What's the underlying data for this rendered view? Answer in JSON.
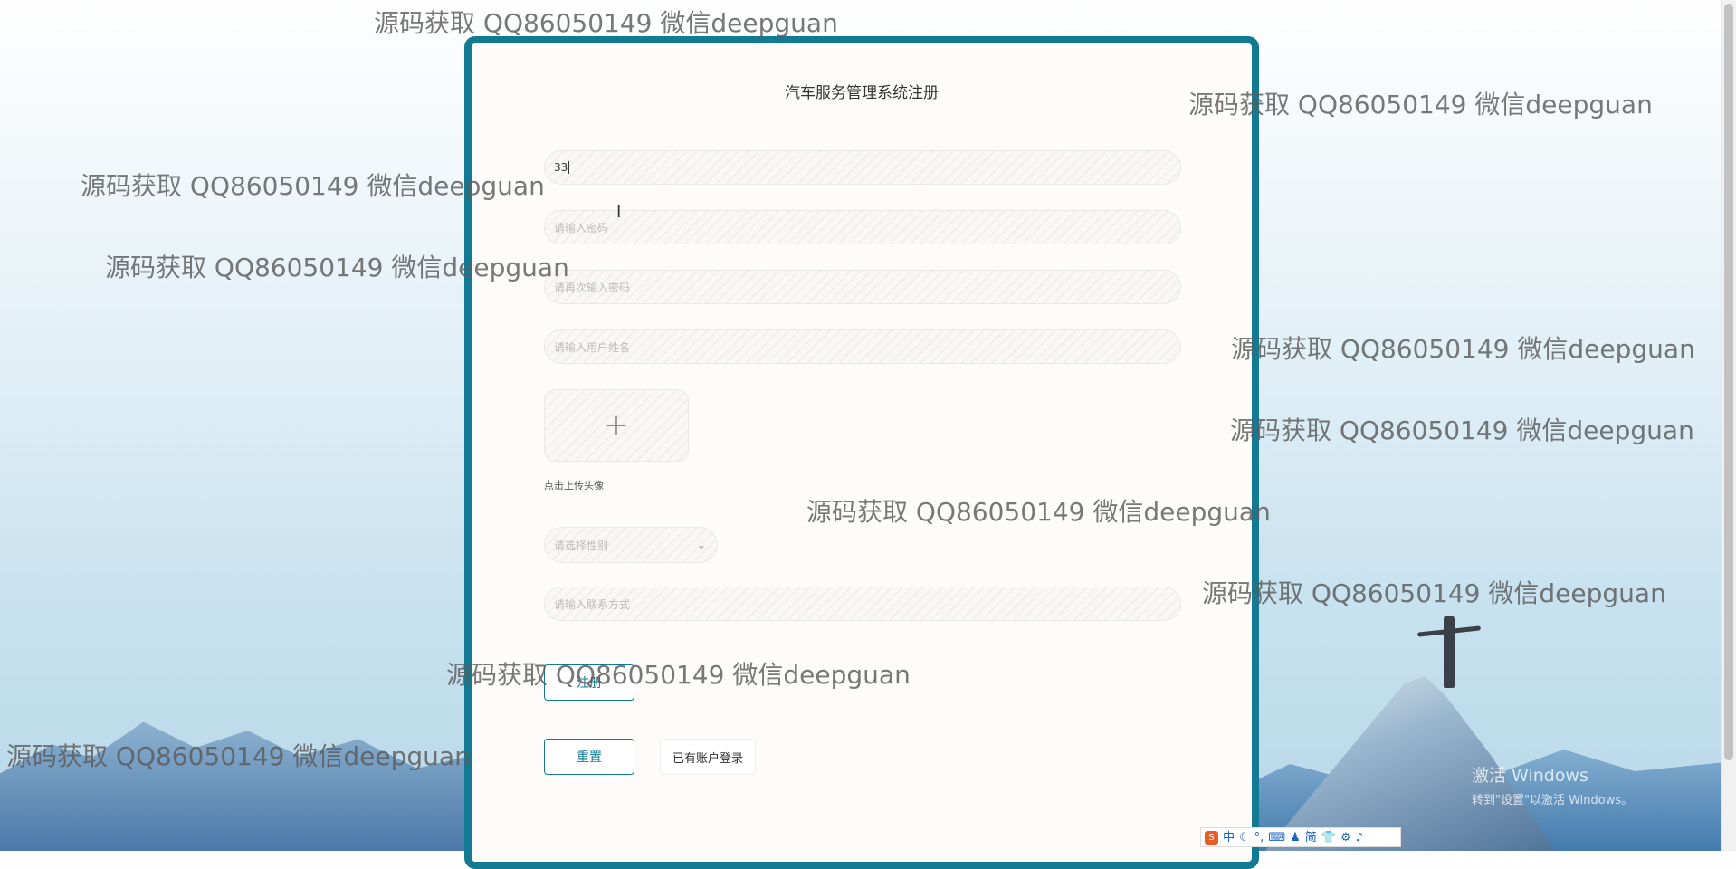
{
  "form": {
    "title": "汽车服务管理系统注册",
    "account_value": "33",
    "password_placeholder": "请输入密码",
    "confirm_password_placeholder": "请再次输入密码",
    "name_placeholder": "请输入用户姓名",
    "upload_plus": "+",
    "upload_hint": "点击上传头像",
    "gender_placeholder": "请选择性别",
    "phone_placeholder": "请输入联系方式",
    "register_label": "注册",
    "reset_label": "重置",
    "login_link_label": "已有账户登录"
  },
  "watermark": {
    "text": "源码获取 QQ86050149 微信deepguan"
  },
  "system": {
    "activate_title": "激活 Windows",
    "activate_subtitle": "转到\"设置\"以激活 Windows。",
    "ime_items": [
      "中",
      "☾",
      "°,",
      "⌨",
      "♟",
      "简",
      "👕",
      "⚙",
      "♪"
    ]
  },
  "colors": {
    "accent": "#127a93",
    "card_bg": "#fdfcfb"
  }
}
